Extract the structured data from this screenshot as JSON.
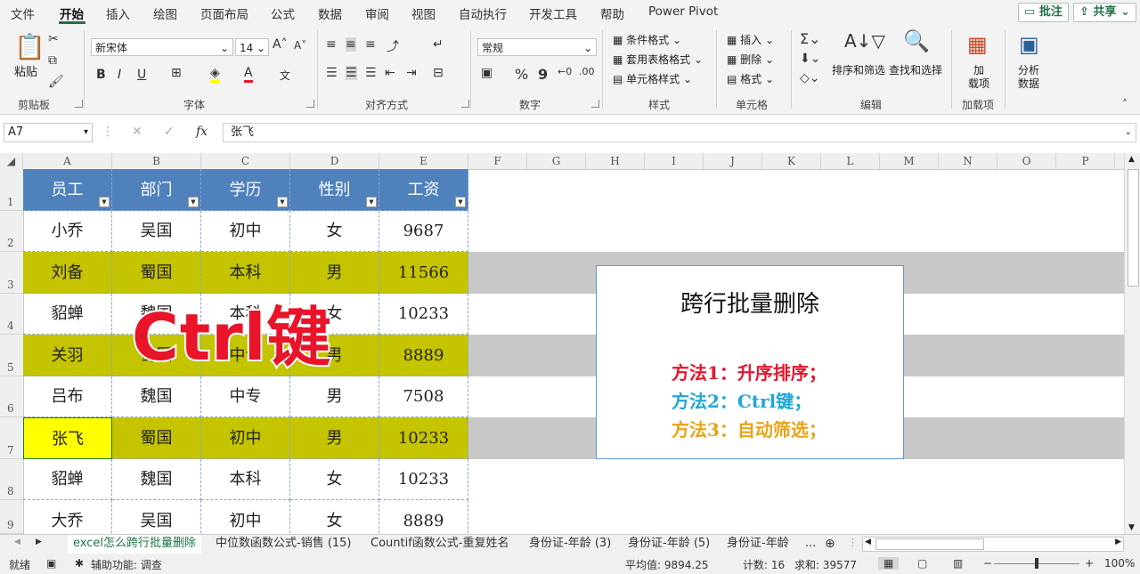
{
  "menu": {
    "items": [
      "文件",
      "开始",
      "插入",
      "绘图",
      "页面布局",
      "公式",
      "数据",
      "审阅",
      "视图",
      "自动执行",
      "开发工具",
      "帮助",
      "Power Pivot"
    ],
    "active": "开始",
    "comment_btn": "批注",
    "share_btn": "共享"
  },
  "ribbon": {
    "clipboard": {
      "paste": "粘贴",
      "label": "剪贴板"
    },
    "font": {
      "name": "新宋体",
      "size": "14",
      "label": "字体",
      "bold": "B",
      "italic": "I",
      "underline": "U",
      "grow": "A",
      "shrink": "A",
      "font_color_letter": "A",
      "phonetic": "文"
    },
    "align": {
      "label": "对齐方式"
    },
    "number": {
      "format": "常规",
      "label": "数字",
      "percent": "%",
      "comma": "9"
    },
    "styles": {
      "cond": "条件格式",
      "table": "套用表格格式",
      "cell": "单元格样式",
      "label": "样式"
    },
    "cells": {
      "insert": "插入",
      "delete": "删除",
      "format": "格式",
      "label": "单元格"
    },
    "editing": {
      "sort": "排序和筛选",
      "find": "查找和选择",
      "label": "编辑"
    },
    "addins": {
      "line1": "加",
      "line2": "载项",
      "label": "加载项"
    },
    "analyze": {
      "line1": "分析",
      "line2": "数据"
    }
  },
  "formula_bar": {
    "name_box": "A7",
    "fx": "fx",
    "content": "张飞"
  },
  "columns": [
    "A",
    "B",
    "C",
    "D",
    "E",
    "F",
    "G",
    "H",
    "I",
    "J",
    "K",
    "L",
    "M",
    "N",
    "O",
    "P"
  ],
  "rows": [
    "1",
    "2",
    "3",
    "4",
    "5",
    "6",
    "7",
    "8",
    "9"
  ],
  "table": {
    "headers": [
      "员工",
      "部门",
      "学历",
      "性别",
      "工资"
    ],
    "rows": [
      [
        "小乔",
        "吴国",
        "初中",
        "女",
        "9687"
      ],
      [
        "刘备",
        "蜀国",
        "本科",
        "男",
        "11566"
      ],
      [
        "貂蝉",
        "魏国",
        "本科",
        "女",
        "10233"
      ],
      [
        "关羽",
        "蜀国",
        "中专",
        "男",
        "8889"
      ],
      [
        "吕布",
        "魏国",
        "中专",
        "男",
        "7508"
      ],
      [
        "张飞",
        "蜀国",
        "初中",
        "男",
        "10233"
      ],
      [
        "貂蝉",
        "魏国",
        "本科",
        "女",
        "10233"
      ],
      [
        "大乔",
        "吴国",
        "初中",
        "女",
        "8889"
      ]
    ]
  },
  "overlay_text": "Ctrl键",
  "textbox": {
    "title": "跨行批量删除",
    "methods": [
      {
        "text": "方法1：升序排序；",
        "color": "#e8142a"
      },
      {
        "text": "方法2：Ctrl键；",
        "color": "#1ea7d8"
      },
      {
        "text": "方法3：自动筛选；",
        "color": "#e8a317"
      }
    ]
  },
  "colors": {
    "header_blue": "#4f81bd",
    "highlight_olive": "#c4c400",
    "selected_yellow": "#ffff00",
    "band_gray": "#c8c8c8",
    "excel_green": "#217346"
  },
  "sheets": [
    "excel怎么跨行批量删除",
    "中位数函数公式-销售 (15)",
    "Countif函数公式-重复姓名",
    "身份证-年龄 (3)",
    "身份证-年龄 (5)",
    "身份证-年龄",
    "..."
  ],
  "status": {
    "ready": "就绪",
    "accessibility": "辅助功能: 调查",
    "average": "平均值: 9894.25",
    "count": "计数: 16",
    "sum": "求和: 39577",
    "zoom": "100%"
  }
}
